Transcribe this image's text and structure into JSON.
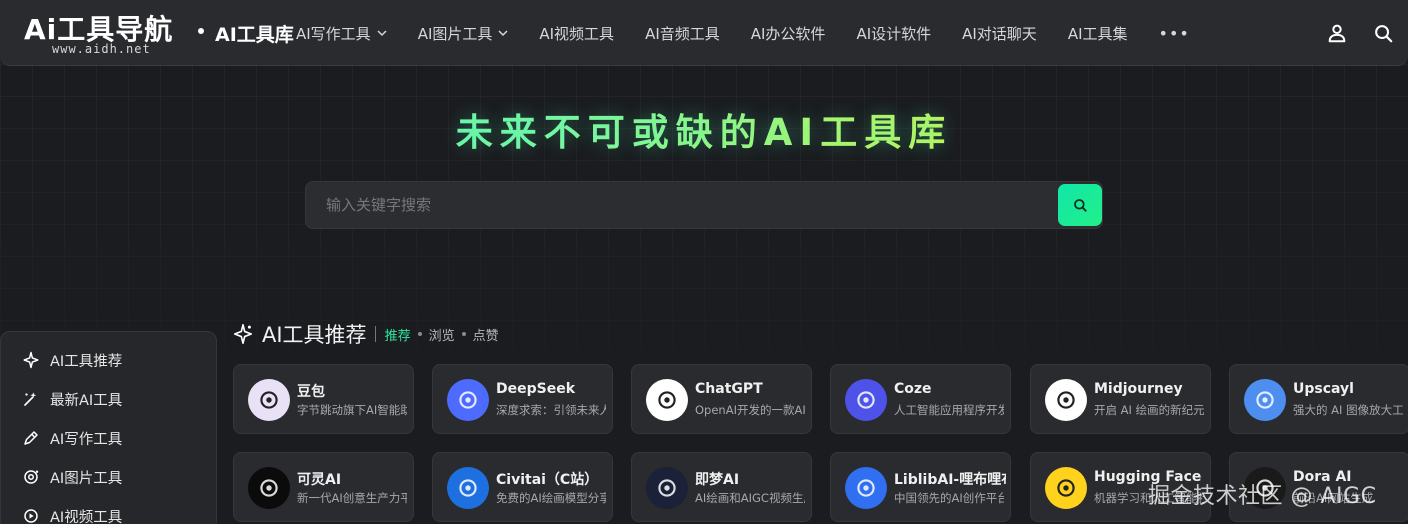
{
  "header": {
    "logo_main": "Ai工具导航",
    "logo_sub": "www.aidh.net",
    "site_name": "AI工具库",
    "nav": [
      {
        "label": "AI写作工具",
        "has_dropdown": true
      },
      {
        "label": "AI图片工具",
        "has_dropdown": true
      },
      {
        "label": "AI视频工具",
        "has_dropdown": false
      },
      {
        "label": "AI音频工具",
        "has_dropdown": false
      },
      {
        "label": "AI办公软件",
        "has_dropdown": false
      },
      {
        "label": "AI设计软件",
        "has_dropdown": false
      },
      {
        "label": "AI对话聊天",
        "has_dropdown": false
      },
      {
        "label": "AI工具集",
        "has_dropdown": false
      }
    ],
    "more_label": "•••",
    "icons": [
      "user-icon",
      "search-icon"
    ]
  },
  "hero": {
    "title": "未来不可或缺的AI工具库",
    "search_placeholder": "输入关键字搜索"
  },
  "section": {
    "title": "AI工具推荐",
    "tabs": [
      "推荐",
      "浏览",
      "点赞"
    ],
    "active_tab": "推荐"
  },
  "cards": [
    {
      "name": "豆包",
      "desc": "字节跳动旗下AI智能助手",
      "icon": "doubao-avatar-icon",
      "color": "#e9e2f7"
    },
    {
      "name": "DeepSeek",
      "desc": "深度求索：引领未来人工智能",
      "icon": "deepseek-whale-icon",
      "color": "#4d6bfe"
    },
    {
      "name": "ChatGPT",
      "desc": "OpenAI开发的一款AI聊天机器人",
      "icon": "openai-icon",
      "color": "#ffffff"
    },
    {
      "name": "Coze",
      "desc": "人工智能应用程序开发平台",
      "icon": "coze-ghost-icon",
      "color": "#4d53e8"
    },
    {
      "name": "Midjourney",
      "desc": "开启 AI 绘画的新纪元",
      "icon": "midjourney-boat-icon",
      "color": "#ffffff"
    },
    {
      "name": "Upscayl",
      "desc": "强大的 AI 图像放大工具",
      "icon": "upscayl-icon",
      "color": "#4d8ef0"
    },
    {
      "name": "可灵AI",
      "desc": "新一代AI创意生产力平台",
      "icon": "kling-icon",
      "color": "#0b0b0b"
    },
    {
      "name": "Civitai（C站）",
      "desc": "免费的AI绘画模型分享平台",
      "icon": "civitai-icon",
      "color": "#1e6fe0"
    },
    {
      "name": "即梦AI",
      "desc": "AI绘画和AIGC视频生成平台",
      "icon": "jimeng-icon",
      "color": "#1a2138"
    },
    {
      "name": "LiblibAI-哩布哩布AI",
      "desc": "中国领先的AI创作平台",
      "icon": "liblib-icon",
      "color": "#2f6ff0"
    },
    {
      "name": "Hugging Face",
      "desc": "机器学习和人工智能社区",
      "icon": "hugging-face-icon",
      "color": "#ffd21e"
    },
    {
      "name": "Dora AI",
      "desc": "前沿AI网站生成",
      "icon": "dora-icon",
      "color": "#1a1a1a"
    }
  ],
  "sidebar": {
    "items": [
      {
        "label": "AI工具推荐",
        "icon": "sparkle-icon"
      },
      {
        "label": "最新AI工具",
        "icon": "new-tools-icon"
      },
      {
        "label": "AI写作工具",
        "icon": "pen-icon"
      },
      {
        "label": "AI图片工具",
        "icon": "image-icon"
      },
      {
        "label": "AI视频工具",
        "icon": "video-icon"
      }
    ]
  },
  "watermark": "掘金技术社区 @ AIGC"
}
